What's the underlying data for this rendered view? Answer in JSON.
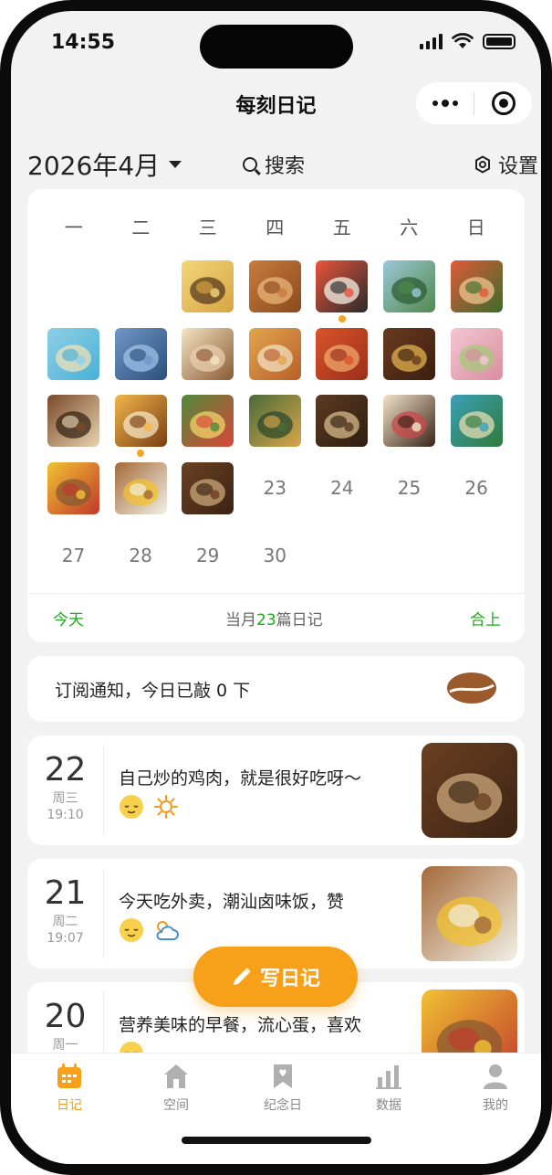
{
  "status": {
    "time": "14:55"
  },
  "nav": {
    "title": "每刻日记"
  },
  "toolbar": {
    "month": "2026年4月",
    "search_label": "搜索",
    "settings_label": "设置"
  },
  "calendar": {
    "weekdays": [
      "一",
      "二",
      "三",
      "四",
      "五",
      "六",
      "日"
    ],
    "photo_days": [
      {
        "day": 1,
        "photo": "lemon-tea"
      },
      {
        "day": 2,
        "photo": "chicken-wings"
      },
      {
        "day": 3,
        "photo": "sushi",
        "marked": true
      },
      {
        "day": 4,
        "photo": "lake"
      },
      {
        "day": 5,
        "photo": "sashimi-platter"
      },
      {
        "day": 6,
        "photo": "beach"
      },
      {
        "day": 7,
        "photo": "city-skyline"
      },
      {
        "day": 8,
        "photo": "cake-slice"
      },
      {
        "day": 9,
        "photo": "noodle-box"
      },
      {
        "day": 10,
        "photo": "spaghetti"
      },
      {
        "day": 11,
        "photo": "steak-pasta"
      },
      {
        "day": 12,
        "photo": "cherry-blossom"
      },
      {
        "day": 13,
        "photo": "coffee-breakfast"
      },
      {
        "day": 14,
        "photo": "pudding",
        "marked": true
      },
      {
        "day": 15,
        "photo": "salad"
      },
      {
        "day": 16,
        "photo": "forest-stream"
      },
      {
        "day": 17,
        "photo": "braised-meat"
      },
      {
        "day": 18,
        "photo": "cheesecake"
      },
      {
        "day": 19,
        "photo": "tropical-bay"
      },
      {
        "day": 20,
        "photo": "egg-breakfast"
      },
      {
        "day": 21,
        "photo": "braised-rice"
      },
      {
        "day": 22,
        "photo": "stir-fried-chicken"
      }
    ],
    "number_days": [
      "23",
      "24",
      "25",
      "26",
      "27",
      "28",
      "29",
      "30"
    ],
    "footer": {
      "today": "今天",
      "count_prefix": "当月",
      "count": "23",
      "count_suffix": "篇日记",
      "collapse": "合上"
    }
  },
  "notify": {
    "text": "订阅通知，今日已敲 0 下"
  },
  "entries": [
    {
      "day": "22",
      "weekday": "周三",
      "time": "19:10",
      "text": "自己炒的鸡肉，就是很好吃呀～",
      "mood": "content-face-icon",
      "weather": "sun-icon",
      "photo": "stir-fried-chicken"
    },
    {
      "day": "21",
      "weekday": "周二",
      "time": "19:07",
      "text": "今天吃外卖，潮汕卤味饭，赞",
      "mood": "relieved-face-icon",
      "weather": "partly-cloudy-icon",
      "photo": "braised-rice"
    },
    {
      "day": "20",
      "weekday": "周一",
      "time": "",
      "text": "营养美味的早餐，流心蛋，喜欢",
      "mood": "happy-face-icon",
      "weather": "",
      "photo": "egg-breakfast"
    }
  ],
  "fab": {
    "label": "写日记"
  },
  "tabs": [
    {
      "label": "日记",
      "active": true,
      "icon": "calendar-icon"
    },
    {
      "label": "空间",
      "icon": "home-icon"
    },
    {
      "label": "纪念日",
      "icon": "bookmark-heart-icon"
    },
    {
      "label": "数据",
      "icon": "bar-chart-icon"
    },
    {
      "label": "我的",
      "icon": "person-icon"
    }
  ],
  "colors": {
    "accent": "#f7a01a",
    "green": "#1aad19",
    "mark": "#f5a623"
  }
}
